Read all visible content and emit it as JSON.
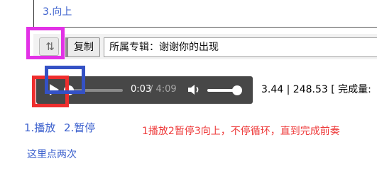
{
  "step3_label": "3.向上",
  "toolbar": {
    "up_button_glyph": "⇅",
    "copy_label": "复制",
    "album_text": "所属专辑：谢谢你的出现"
  },
  "player": {
    "current_time": "0:03",
    "total_time": "/ 4:09",
    "progress_fraction": 0.012,
    "volume_fraction": 0.8
  },
  "stats_text": "3.44 | 248.53 [ 完成量:",
  "annotations": {
    "step1": "1.播放",
    "step2": "2.暂停",
    "instruction": "1播放2暂停3向上，不停循环，直到完成前奏",
    "click_twice": "这里点两次"
  },
  "colors": {
    "magenta_box": "#e231e6",
    "red_box": "#ee2d2d",
    "blue_box": "#3451c5",
    "note_blue": "#3a5fcd",
    "note_red": "#ee3b3b",
    "player_bg": "#474747"
  }
}
